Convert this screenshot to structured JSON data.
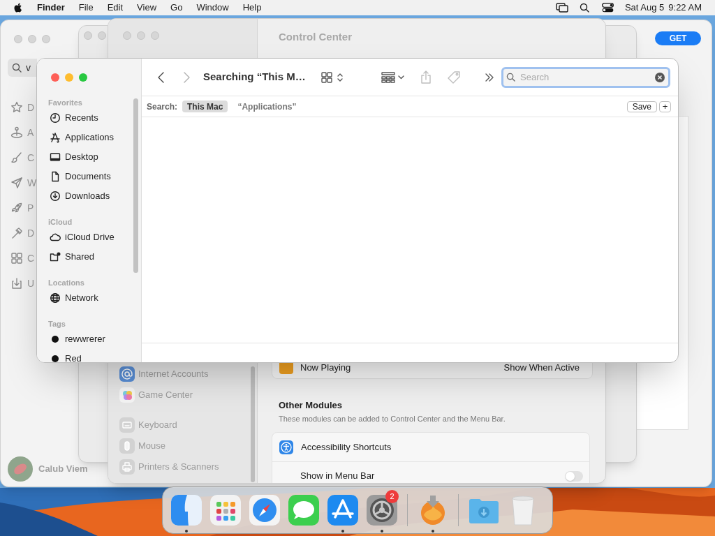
{
  "menu_bar": {
    "app": "Finder",
    "menus": [
      "File",
      "Edit",
      "View",
      "Go",
      "Window",
      "Help"
    ],
    "date": "Sat Aug 5",
    "time": "9:22 AM"
  },
  "app_store_window": {
    "search_value": "v",
    "sidebar": [
      {
        "label": "D",
        "kind": "star"
      },
      {
        "label": "A",
        "kind": "joystick"
      },
      {
        "label": "C",
        "kind": "brush"
      },
      {
        "label": "W",
        "kind": "plane"
      },
      {
        "label": "P",
        "kind": "rocket"
      },
      {
        "label": "D",
        "kind": "hammer"
      },
      {
        "label": "C",
        "kind": "grid"
      },
      {
        "label": "U",
        "kind": "update"
      }
    ],
    "user": "Calub Viem",
    "get_button": "GET"
  },
  "settings_window": {
    "title": "Control Center",
    "sidebar_groups": [
      [
        {
          "label": "Internet Accounts",
          "kind": "at"
        },
        {
          "label": "Game Center",
          "kind": "game"
        }
      ],
      [
        {
          "label": "Keyboard",
          "kind": "keyboard"
        },
        {
          "label": "Mouse",
          "kind": "mouse"
        },
        {
          "label": "Printers & Scanners",
          "kind": "printer"
        }
      ]
    ],
    "now_playing": {
      "label": "Now Playing",
      "value": "Show When Active"
    },
    "section": {
      "title": "Other Modules",
      "subtitle": "These modules can be added to Control Center and the Menu Bar."
    },
    "module": {
      "label": "Accessibility Shortcuts",
      "toggle_label": "Show in Menu Bar",
      "on": false
    }
  },
  "finder": {
    "title": "Searching “This M…",
    "search": {
      "placeholder": "Search"
    },
    "scope_label": "Search:",
    "scopes": [
      {
        "label": "This Mac",
        "selected": true
      },
      {
        "label": "“Applications”",
        "selected": false
      }
    ],
    "save_button": "Save",
    "add_button": "+",
    "sidebar": [
      {
        "heading": "Favorites",
        "items": [
          {
            "label": "Recents",
            "kind": "clock"
          },
          {
            "label": "Applications",
            "kind": "apps"
          },
          {
            "label": "Desktop",
            "kind": "desktop"
          },
          {
            "label": "Documents",
            "kind": "document"
          },
          {
            "label": "Downloads",
            "kind": "download"
          }
        ]
      },
      {
        "heading": "iCloud",
        "items": [
          {
            "label": "iCloud Drive",
            "kind": "cloud"
          },
          {
            "label": "Shared",
            "kind": "shared"
          }
        ]
      },
      {
        "heading": "Locations",
        "items": [
          {
            "label": "Network",
            "kind": "network"
          }
        ]
      },
      {
        "heading": "Tags",
        "items": [
          {
            "label": "rewwrerer",
            "kind": "tag"
          },
          {
            "label": "Red",
            "kind": "tag"
          }
        ]
      }
    ]
  },
  "dock": {
    "items": [
      {
        "kind": "finder",
        "running": true
      },
      {
        "kind": "launchpad",
        "running": false
      },
      {
        "kind": "safari",
        "running": false
      },
      {
        "kind": "messages",
        "running": false
      },
      {
        "kind": "appstore",
        "running": true
      },
      {
        "kind": "settings",
        "running": true,
        "badge": "2"
      },
      {
        "kind": "separator"
      },
      {
        "kind": "installer",
        "running": true
      },
      {
        "kind": "separator"
      },
      {
        "kind": "folder",
        "running": false
      },
      {
        "kind": "trash",
        "running": false
      }
    ]
  }
}
